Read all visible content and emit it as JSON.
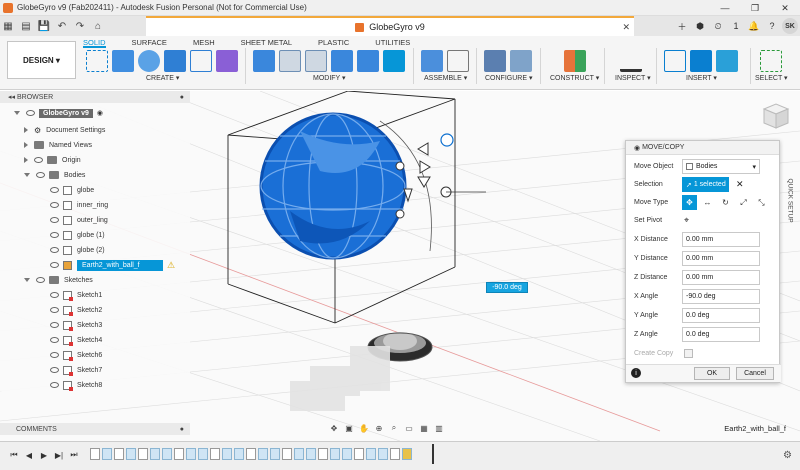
{
  "window": {
    "title": "GlobeGyro v9 (Fab202411) - Autodesk Fusion Personal (Not for Commercial Use)",
    "controls": [
      "—",
      "❐",
      "✕"
    ]
  },
  "doc_tab": {
    "title": "GlobeGyro v9"
  },
  "toprow": {
    "job_count": "1",
    "avatar": "SK"
  },
  "ribbon": {
    "design_label": "DESIGN",
    "tabs": [
      "SOLID",
      "SURFACE",
      "MESH",
      "SHEET METAL",
      "PLASTIC",
      "UTILITIES"
    ],
    "groups": [
      "CREATE",
      "MODIFY",
      "ASSEMBLE",
      "CONFIGURE",
      "CONSTRUCT",
      "INSPECT",
      "INSERT",
      "SELECT"
    ]
  },
  "browser": {
    "header": "BROWSER",
    "root": "GlobeGyro v9",
    "items": [
      {
        "label": "Document Settings"
      },
      {
        "label": "Named Views"
      },
      {
        "label": "Origin"
      },
      {
        "label": "Bodies"
      },
      {
        "label": "globe"
      },
      {
        "label": "inner_ring"
      },
      {
        "label": "outer_ling"
      },
      {
        "label": "globe (1)"
      },
      {
        "label": "globe (2)"
      },
      {
        "label": "Earth2_with_ball_f"
      },
      {
        "label": "Sketches"
      },
      {
        "label": "Sketch1"
      },
      {
        "label": "Sketch2"
      },
      {
        "label": "Sketch3"
      },
      {
        "label": "Sketch4"
      },
      {
        "label": "Sketch6"
      },
      {
        "label": "Sketch7"
      },
      {
        "label": "Sketch8"
      }
    ]
  },
  "viewport": {
    "angle_input": "-90.0 deg"
  },
  "dialog": {
    "title": "MOVE/COPY",
    "move_object_label": "Move Object",
    "move_object_value": "Bodies",
    "selection_label": "Selection",
    "selection_value": "1 selected",
    "move_type_label": "Move Type",
    "set_pivot_label": "Set Pivot",
    "x_distance_label": "X Distance",
    "x_distance": "0.00 mm",
    "y_distance_label": "Y Distance",
    "y_distance": "0.00 mm",
    "z_distance_label": "Z Distance",
    "z_distance": "0.00 mm",
    "x_angle_label": "X Angle",
    "x_angle": "-90.0 deg",
    "y_angle_label": "Y Angle",
    "y_angle": "0.0 deg",
    "z_angle_label": "Z Angle",
    "z_angle": "0.0 deg",
    "create_copy_label": "Create Copy",
    "ok_label": "OK",
    "cancel_label": "Cancel"
  },
  "quick_setup": "QUICK SETUP",
  "comments": {
    "label": "COMMENTS"
  },
  "status": {
    "selected_name": "Earth2_with_ball_f"
  },
  "colors": {
    "accent": "#0696d7",
    "model_blue": "#1a6fd6"
  }
}
